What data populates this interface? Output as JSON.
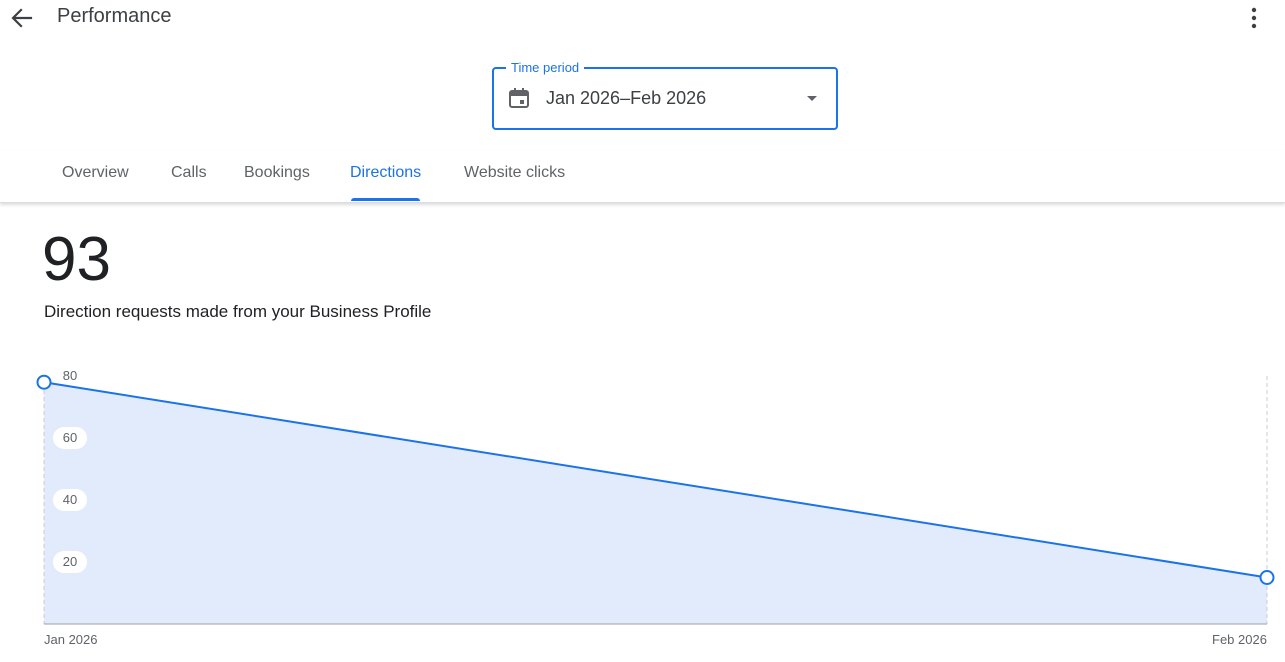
{
  "header": {
    "title": "Performance",
    "back_icon": "arrow-back-icon",
    "more_icon": "more-vert-icon"
  },
  "time_period": {
    "label": "Time period",
    "value": "Jan 2026–Feb 2026",
    "icon": "calendar-icon",
    "dropdown_icon": "arrow-drop-down-icon"
  },
  "tabs": [
    {
      "label": "Overview",
      "active": false
    },
    {
      "label": "Calls",
      "active": false
    },
    {
      "label": "Bookings",
      "active": false
    },
    {
      "label": "Directions",
      "active": true
    },
    {
      "label": "Website clicks",
      "active": false
    }
  ],
  "summary": {
    "value": "93",
    "caption": "Direction requests made from your Business Profile"
  },
  "colors": {
    "accent": "#1a73e8",
    "area_fill": "#e2ebfb",
    "text": "#202124",
    "muted_text": "#5f6368"
  },
  "chart_data": {
    "type": "area",
    "categories": [
      "Jan 2026",
      "Feb 2026"
    ],
    "series": [
      {
        "values": [
          78,
          15
        ]
      }
    ],
    "ylim": [
      0,
      80
    ],
    "yticks": [
      20,
      40,
      60,
      80
    ],
    "grid": false,
    "title": "",
    "xlabel": "",
    "ylabel": ""
  }
}
